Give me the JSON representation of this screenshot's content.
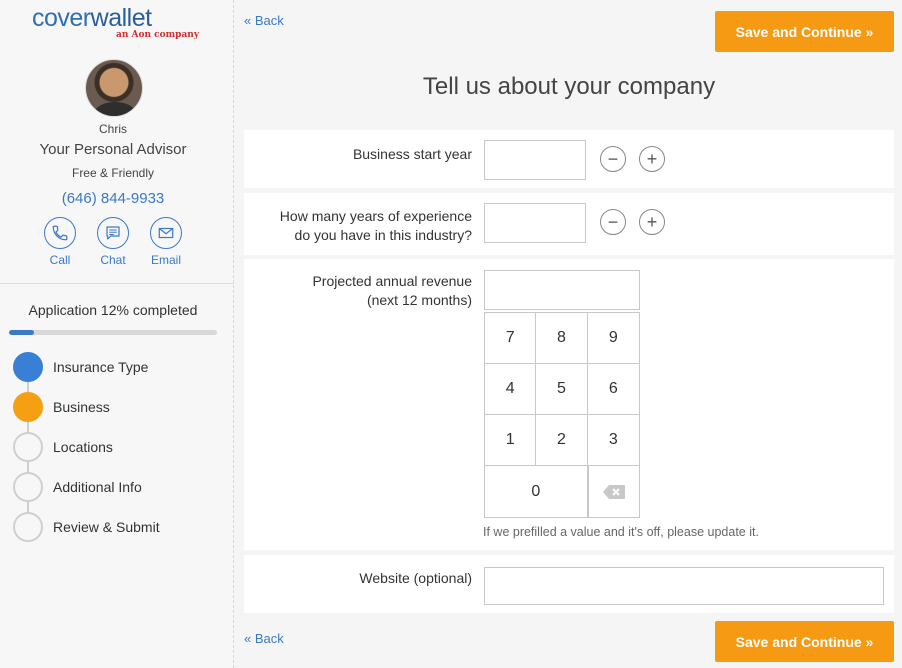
{
  "brand": {
    "logo_part1": "cover",
    "logo_part2": "wallet",
    "logo_sub": "an Aon company",
    "accent": "#3a79c8",
    "cta": "#f59a12"
  },
  "advisor": {
    "name": "Chris",
    "title": "Your Personal Advisor",
    "tagline": "Free & Friendly",
    "phone": "(646) 844-9933",
    "contacts": [
      {
        "label": "Call",
        "icon": "phone-icon"
      },
      {
        "label": "Chat",
        "icon": "chat-icon"
      },
      {
        "label": "Email",
        "icon": "email-icon"
      }
    ]
  },
  "progress": {
    "label": "Application 12% completed",
    "percent": 12
  },
  "steps": [
    {
      "label": "Insurance Type",
      "status": "complete"
    },
    {
      "label": "Business",
      "status": "current"
    },
    {
      "label": "Locations",
      "status": "pending"
    },
    {
      "label": "Additional Info",
      "status": "pending"
    },
    {
      "label": "Review & Submit",
      "status": "pending"
    }
  ],
  "nav": {
    "back_label": "« Back",
    "save_label": "Save and Continue »"
  },
  "page": {
    "title": "Tell us about your company"
  },
  "form": {
    "start_year_label": "Business start year",
    "start_year_value": "",
    "experience_label_1": "How many years of experience",
    "experience_label_2": "do you have in this industry?",
    "experience_value": "",
    "revenue_label_1": "Projected annual revenue",
    "revenue_label_2": "(next 12 months)",
    "revenue_value": "",
    "keypad": [
      "7",
      "8",
      "9",
      "4",
      "5",
      "6",
      "1",
      "2",
      "3",
      "0"
    ],
    "hint": "If we prefilled a value and it's off, please update it.",
    "website_label": "Website (optional)",
    "website_value": ""
  }
}
